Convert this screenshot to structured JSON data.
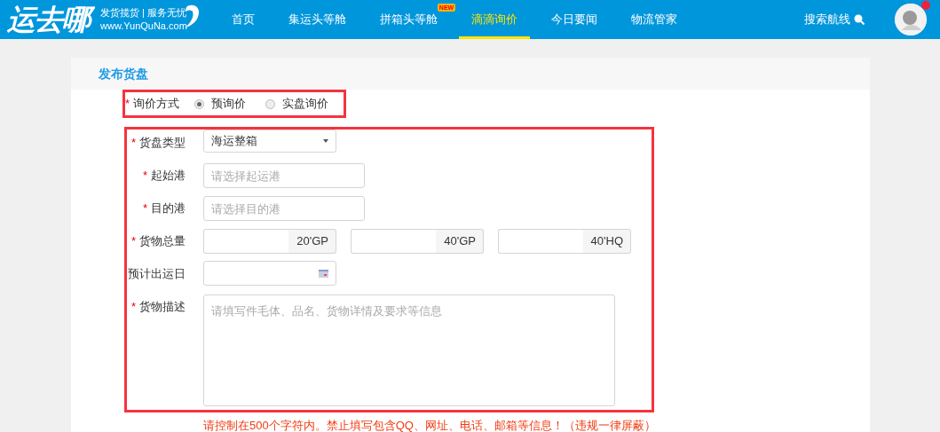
{
  "header": {
    "logo": "运去哪",
    "slogan": "发货揽货 | 服务无忧",
    "site_url": "www.YunQuNa.com",
    "nav": [
      {
        "label": "首页",
        "selected": false
      },
      {
        "label": "集运头等舱",
        "selected": false
      },
      {
        "label": "拼箱头等舱",
        "selected": false,
        "badge": "NEW"
      },
      {
        "label": "滴滴询价",
        "selected": true
      },
      {
        "label": "今日要闻",
        "selected": false
      },
      {
        "label": "物流管家",
        "selected": false
      }
    ],
    "search_label": "搜索航线",
    "notification": true
  },
  "form": {
    "title": "发布货盘",
    "required_mark": "*",
    "inquiry": {
      "label": "询价方式",
      "required": true,
      "options": [
        {
          "label": "预询价",
          "selected": true
        },
        {
          "label": "实盘询价",
          "selected": false
        }
      ]
    },
    "fields": [
      {
        "kind": "select",
        "label": "货盘类型",
        "required": true,
        "value": "海运整箱"
      },
      {
        "kind": "text",
        "label": "起始港",
        "required": true,
        "placeholder": "请选择起运港"
      },
      {
        "kind": "text",
        "label": "目的港",
        "required": true,
        "placeholder": "请选择目的港"
      },
      {
        "kind": "quantity",
        "label": "货物总量",
        "required": true,
        "units": [
          "20'GP",
          "40'GP",
          "40'HQ"
        ]
      },
      {
        "kind": "date",
        "label": "预计出运日",
        "required": false
      },
      {
        "kind": "textarea",
        "label": "货物描述",
        "required": true,
        "placeholder": "请填写件毛体、品名、货物详情及要求等信息"
      }
    ],
    "note": "请控制在500个字符内。禁止填写包含QQ、网址、电话、邮箱等信息！（违规一律屏蔽）"
  }
}
